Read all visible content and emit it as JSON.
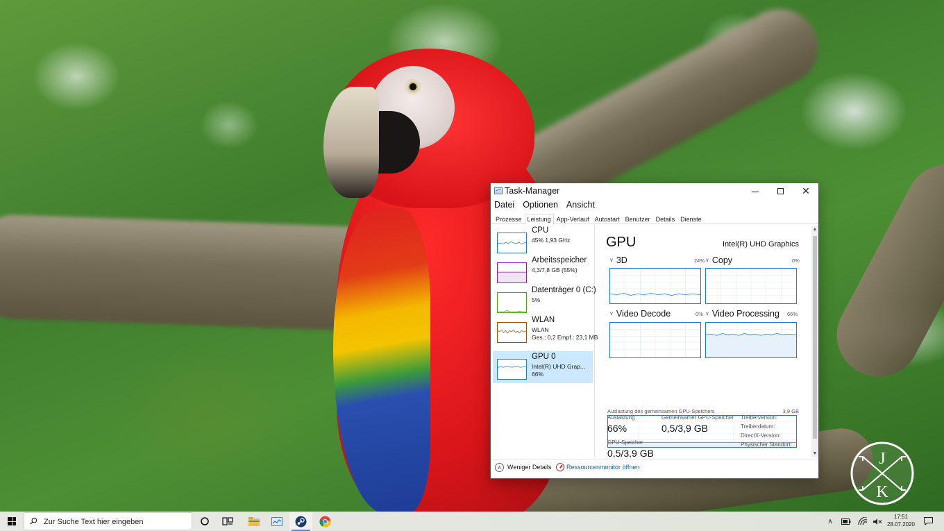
{
  "window": {
    "title": "Task-Manager",
    "minimize_symbol": "—",
    "maximize_symbol": "☐",
    "close_symbol": "✕"
  },
  "menu": [
    "Datei",
    "Optionen",
    "Ansicht"
  ],
  "tabs": [
    "Prozesse",
    "Leistung",
    "App-Verlauf",
    "Autostart",
    "Benutzer",
    "Details",
    "Dienste"
  ],
  "active_tab": "Leistung",
  "resources": [
    {
      "title": "CPU",
      "line1": "45% 1,93 GHz",
      "line2": "",
      "color": "#1b7fcf"
    },
    {
      "title": "Arbeitsspeicher",
      "line1": "4,3/7,8 GB (55%)",
      "line2": "",
      "color": "#8b1fa9"
    },
    {
      "title": "Datenträger 0 (C:)",
      "line1": "5%",
      "line2": "",
      "color": "#4da60c"
    },
    {
      "title": "WLAN",
      "line1": "WLAN",
      "line2": "Ges.: 0,2  Empf.: 23,1 MB",
      "color": "#a74f01"
    },
    {
      "title": "GPU 0",
      "line1": "Intel(R) UHD Grap...",
      "line2": "66%",
      "color": "#1b7fcf"
    }
  ],
  "detail": {
    "heading": "GPU",
    "model": "Intel(R) UHD Graphics",
    "engines": [
      {
        "name": "3D",
        "percent": "24%"
      },
      {
        "name": "Copy",
        "percent": "0%"
      },
      {
        "name": "Video Decode",
        "percent": "0%"
      },
      {
        "name": "Video Processing",
        "percent": "66%"
      }
    ],
    "shared_memory_label": "Auslastung des gemeinsamen GPU-Speichers",
    "shared_memory_max": "3,9 GB",
    "stats": {
      "utilization_label": "Auslastung",
      "utilization_value": "66%",
      "shared_label": "Gemeinsamer GPU-Speicher",
      "shared_value": "0,5/3,9 GB",
      "gpu_mem_label": "GPU-Speicher",
      "gpu_mem_value": "0,5/3,9 GB",
      "driver_version_label": "Treiberversion:",
      "driver_date_label": "Treiberdatum:",
      "directx_label": "DirectX-Version:",
      "location_label": "Physischer Standort:"
    }
  },
  "footer": {
    "less_details": "Weniger Details",
    "resource_monitor": "Ressourcenmonitor öffnen"
  },
  "taskbar": {
    "search_placeholder": "Zur Suche Text hier eingeben",
    "pinned": [
      "cortana-icon",
      "task-view-icon",
      "file-explorer-icon",
      "task-manager-icon",
      "steam-icon",
      "chrome-icon"
    ],
    "active_app": "steam-icon",
    "time": "17:51",
    "date": "28.07.2020"
  },
  "logo_letters": [
    "J",
    "K"
  ],
  "colors": {
    "accent": "#1b7fcf",
    "selection": "#cce8ff",
    "link": "#0a62b8"
  }
}
